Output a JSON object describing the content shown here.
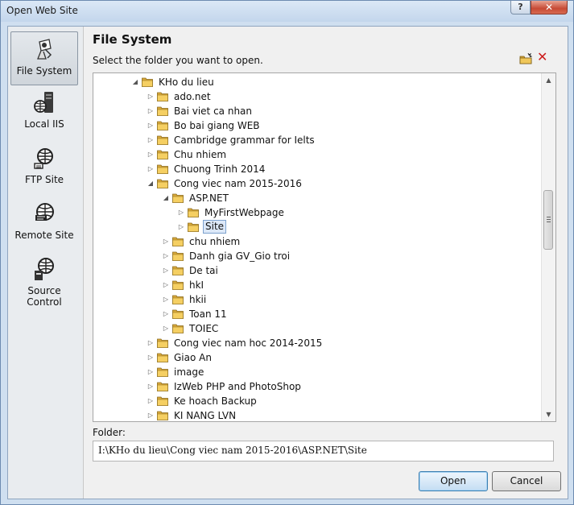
{
  "window": {
    "title": "Open Web Site",
    "help_label": "?",
    "close_label": "✕"
  },
  "nav": {
    "items": [
      {
        "label": "File System",
        "icon": "file-system-icon",
        "selected": true
      },
      {
        "label": "Local IIS",
        "icon": "local-iis-icon"
      },
      {
        "label": "FTP Site",
        "icon": "ftp-site-icon"
      },
      {
        "label": "Remote Site",
        "icon": "remote-site-icon"
      },
      {
        "label": "Source Control",
        "icon": "source-control-icon"
      }
    ]
  },
  "main": {
    "heading": "File System",
    "subtitle": "Select the folder you want to open.",
    "toolbar": {
      "new_folder_icon": "new-folder-icon",
      "delete_icon": "delete-icon",
      "delete_color": "#cc1b1b"
    }
  },
  "tree": {
    "rows": [
      {
        "label": "KHo du lieu",
        "expanded": true
      },
      {
        "label": "ado.net"
      },
      {
        "label": "Bai viet ca nhan"
      },
      {
        "label": "Bo bai giang WEB"
      },
      {
        "label": "Cambridge grammar for Ielts"
      },
      {
        "label": "Chu nhiem"
      },
      {
        "label": "Chuong Trinh 2014"
      },
      {
        "label": "Cong viec nam 2015-2016",
        "expanded": true
      },
      {
        "label": "ASP.NET",
        "expanded": true
      },
      {
        "label": "MyFirstWebpage"
      },
      {
        "label": "Site",
        "selected": true
      },
      {
        "label": "chu nhiem"
      },
      {
        "label": "Danh gia GV_Gio troi"
      },
      {
        "label": "De tai"
      },
      {
        "label": "hkI"
      },
      {
        "label": "hkii"
      },
      {
        "label": "Toan 11"
      },
      {
        "label": "TOIEC"
      },
      {
        "label": "Cong viec nam hoc 2014-2015"
      },
      {
        "label": "Giao An"
      },
      {
        "label": "image"
      },
      {
        "label": "IzWeb PHP and PhotoShop"
      },
      {
        "label": "Ke hoach Backup"
      },
      {
        "label": "KI NANG LVN"
      }
    ]
  },
  "folder": {
    "label": "Folder:",
    "value": "I:\\KHo du lieu\\Cong viec nam 2015-2016\\ASP.NET\\Site"
  },
  "buttons": {
    "open": "Open",
    "cancel": "Cancel"
  }
}
